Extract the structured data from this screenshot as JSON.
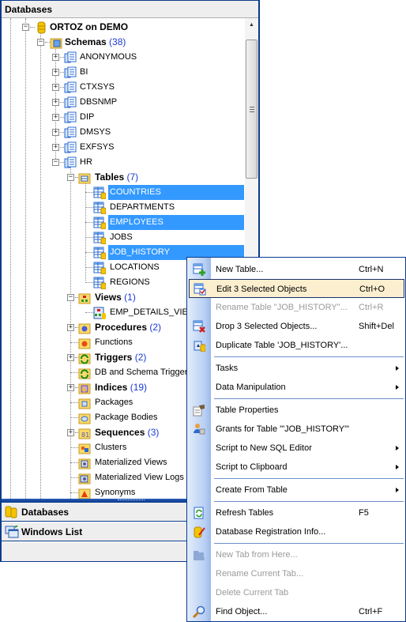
{
  "panel": {
    "title": "Databases",
    "tree": {
      "root": {
        "label": "ORTOZ on DEMO"
      },
      "schemas": {
        "label": "Schemas",
        "count": "(38)"
      },
      "schema_items": [
        "ANONYMOUS",
        "BI",
        "CTXSYS",
        "DBSNMP",
        "DIP",
        "DMSYS",
        "EXFSYS",
        "HR"
      ],
      "tables": {
        "label": "Tables",
        "count": "(7)"
      },
      "table_items": [
        {
          "label": "COUNTRIES",
          "selected": true
        },
        {
          "label": "DEPARTMENTS",
          "selected": false
        },
        {
          "label": "EMPLOYEES",
          "selected": true
        },
        {
          "label": "JOBS",
          "selected": false
        },
        {
          "label": "JOB_HISTORY",
          "selected": true
        },
        {
          "label": "LOCATIONS",
          "selected": false
        },
        {
          "label": "REGIONS",
          "selected": false
        }
      ],
      "views": {
        "label": "Views",
        "count": "(1)"
      },
      "view_items": [
        "EMP_DETAILS_VIEW"
      ],
      "procedures": {
        "label": "Procedures",
        "count": "(2)"
      },
      "functions": {
        "label": "Functions"
      },
      "triggers": {
        "label": "Triggers",
        "count": "(2)"
      },
      "db_schema_triggers": {
        "label": "DB and Schema Triggers"
      },
      "indices": {
        "label": "Indices",
        "count": "(19)"
      },
      "packages": {
        "label": "Packages"
      },
      "package_bodies": {
        "label": "Package Bodies"
      },
      "sequences": {
        "label": "Sequences",
        "count": "(3)"
      },
      "clusters": {
        "label": "Clusters"
      },
      "materialized_views": {
        "label": "Materialized Views"
      },
      "materialized_view_logs": {
        "label": "Materialized View Logs"
      },
      "synonyms": {
        "label": "Synonyms"
      }
    }
  },
  "nav": {
    "databases": "Databases",
    "windows_list": "Windows List"
  },
  "context_menu": {
    "items": [
      {
        "label": "New Table...",
        "shortcut": "Ctrl+N",
        "icon": "new-table-icon"
      },
      {
        "label": "Edit 3 Selected Objects",
        "shortcut": "Ctrl+O",
        "icon": "edit-table-icon",
        "highlighted": true
      },
      {
        "label": "Rename Table \"JOB_HISTORY\"...",
        "shortcut": "Ctrl+R",
        "disabled": true
      },
      {
        "label": "Drop 3 Selected Objects...",
        "shortcut": "Shift+Del",
        "icon": "drop-table-icon"
      },
      {
        "label": "Duplicate Table 'JOB_HISTORY'...",
        "icon": "duplicate-table-icon"
      },
      {
        "label": "Tasks",
        "submenu": true
      },
      {
        "label": "Data Manipulation",
        "submenu": true
      },
      {
        "label": "Table Properties",
        "icon": "properties-icon"
      },
      {
        "label": "Grants for Table '\"JOB_HISTORY\"'",
        "icon": "grants-icon"
      },
      {
        "label": "Script to New SQL Editor",
        "submenu": true
      },
      {
        "label": "Script to Clipboard",
        "submenu": true
      },
      {
        "label": "Create From Table",
        "submenu": true
      },
      {
        "label": "Refresh Tables",
        "shortcut": "F5",
        "icon": "refresh-icon"
      },
      {
        "label": "Database Registration Info...",
        "icon": "db-registration-icon"
      },
      {
        "label": "New Tab from Here...",
        "disabled": true,
        "icon": "new-tab-icon"
      },
      {
        "label": "Rename Current Tab...",
        "disabled": true
      },
      {
        "label": "Delete Current Tab",
        "disabled": true
      },
      {
        "label": "Find Object...",
        "shortcut": "Ctrl+F",
        "icon": "find-icon"
      }
    ]
  },
  "colors": {
    "selection": "#3399ff",
    "frame": "#0a3a8c",
    "count": "#1a3ad4",
    "menu_highlight": "#fcefcf"
  }
}
